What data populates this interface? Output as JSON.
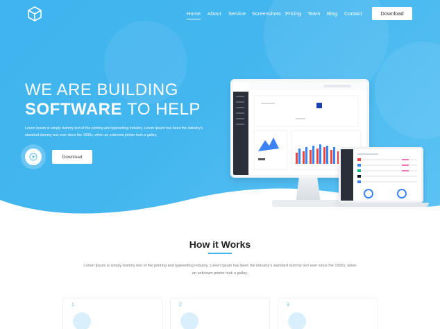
{
  "nav": {
    "items": [
      "Home",
      "About",
      "Service",
      "Screenshots",
      "Pricing",
      "Team",
      "Blog",
      "Contact"
    ],
    "active": "Home",
    "download_label": "Download"
  },
  "hero": {
    "headline_line1": "WE ARE BUILDING",
    "headline_bold": "SOFTWARE",
    "headline_rest": "TO HELP",
    "description": "Lorem Ipsum is simply dummy text of the printing and typesetting industry. Lorem Ipsum has been the industry's standard dummy text ever since the 1500s, when an unknown printer took a galley.",
    "download_label": "Download",
    "play_icon": "play-icon"
  },
  "how_it_works": {
    "title": "How it Works",
    "description": "Lorem Ipsum is simply dummy text of the printing and typesetting industry. Lorem Ipsum has been the industry's standard dummy text ever since the 1500s, when an unknown printer took a galley.",
    "steps": [
      {
        "number": "1"
      },
      {
        "number": "2"
      },
      {
        "number": "3"
      }
    ]
  },
  "colors": {
    "accent": "#3fb4ee",
    "hero_light": "#5cc3f3"
  }
}
